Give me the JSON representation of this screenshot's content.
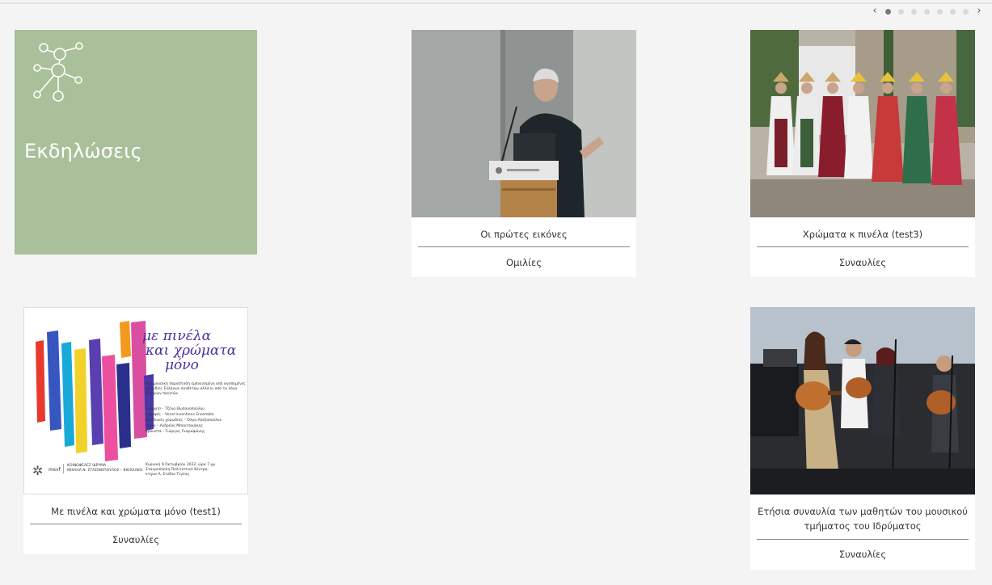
{
  "pager": {
    "prev_icon": "‹",
    "next_icon": "›",
    "dots": 7,
    "active": 0
  },
  "hero": {
    "title": "Εκδηλώσεις",
    "icon": "network-nodes-icon",
    "color": "#a9c09a"
  },
  "cards": [
    {
      "title": "Οι πρώτες εικόνες",
      "category": "Ομιλίες",
      "image": "speaker-at-podium-photo"
    },
    {
      "title": "Χρώματα κ πινέλα (test3)",
      "category": "Συναυλίες",
      "image": "traditional-dancers-photo"
    },
    {
      "title": "Με πινέλα και χρώματα μόνο (test1)",
      "category": "Συναυλίες",
      "image": "event-poster",
      "poster": {
        "heading1": "με πινέλα",
        "heading2": "και χρώματα",
        "heading3": "μόνο",
        "body": "Μια μουσική παράσταση εμπνευσμένη από αγαπημένες μελωδίες Ελλήνων συνθετών αλλά κι από το λόγο Ελλήνων ποιητών",
        "credits": [
          "ενορχήσ – Τζένα Θωπανοπούλου",
          "κορυφές – Vocal Inventions Ensemble",
          "διεύθυνση χορωδίας – Όλγα Αλεξοπούλου",
          "πιάνο – Ανδρέας Μπουτσικάκης",
          "κρουστά – Γιώργος Γκαραφώνης"
        ],
        "org_short": "msvf",
        "org_line1": "ΚΟΙΝΩΦΕΛΕΣ ΙΔΡΥΜΑ",
        "org_line2": "ΜΙΧΑΗΛ Ν. ΣΤΑΣΙΝΟΠΟΥΛΟΣ – ΒΙΟΧΑΛΚΟ",
        "date": "Κυριακή 9 Οκτωβρίου 2022, ώρα 7 μμ",
        "venue1": "Σταυρούπολη Πολιτιστικό Κέντρο,",
        "venue2": "κτίριο Α, Στάδιο Τεγέας"
      }
    },
    {
      "title": "Ετήσια συναυλία των μαθητών του μουσικού τμήματος του Ιδρύματος",
      "category": "Συναυλίες",
      "image": "guitar-concert-photo"
    }
  ]
}
